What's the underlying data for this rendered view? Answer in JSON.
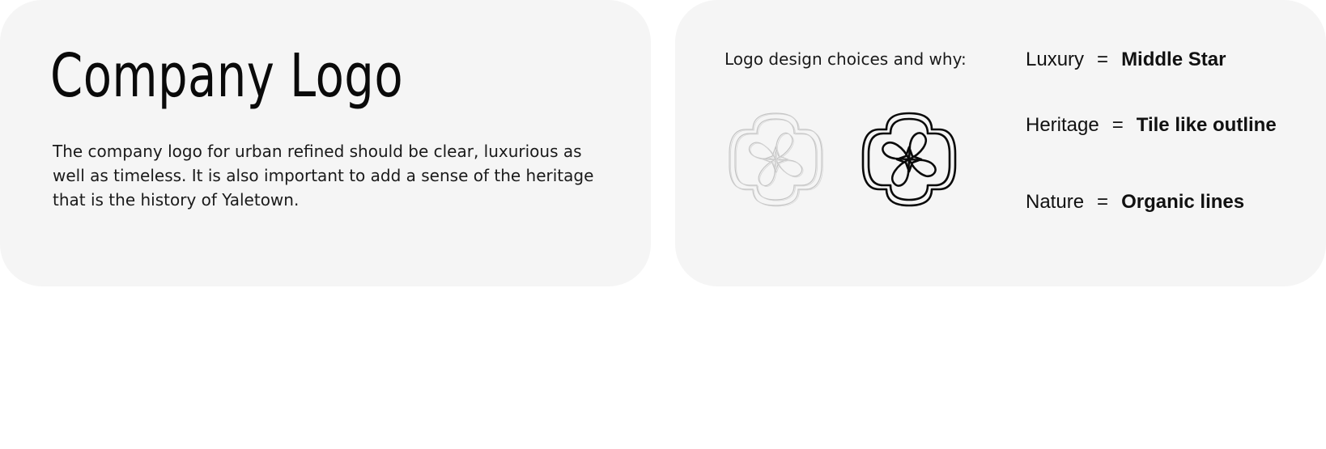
{
  "left_card": {
    "title": "Company Logo",
    "description": "The company logo for urban refined should be clear, luxurious as well as timeless. It is also important to add a sense of the heritage that is the history of Yaletown."
  },
  "right_card": {
    "heading": "Logo design choices and why:",
    "logos": [
      {
        "name": "sketch-logo",
        "style": "light pencil sketch"
      },
      {
        "name": "final-logo",
        "style": "black outline"
      }
    ],
    "pairs": [
      {
        "term": "Luxury",
        "equals": "=",
        "meaning": "Middle Star"
      },
      {
        "term": "Heritage",
        "equals": "=",
        "meaning": "Tile like outline"
      },
      {
        "term": "Nature",
        "equals": "=",
        "meaning": "Organic lines"
      }
    ]
  },
  "colors": {
    "card_background": "#f5f5f5",
    "page_background": "#ffffff",
    "text": "#111111",
    "sketch_stroke": "#bdbdbd"
  }
}
